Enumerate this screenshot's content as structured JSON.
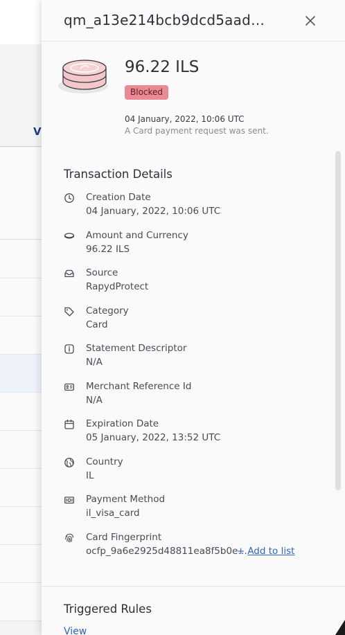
{
  "background": {
    "partial_text": "V"
  },
  "drawer": {
    "title": "qm_a13e214bcb9dcd5aadd...",
    "summary": {
      "amount": "96.22 ILS",
      "status": "Blocked",
      "date": "04 January, 2022, 10:06 UTC",
      "description": "A Card payment request was sent."
    },
    "details_title": "Transaction Details",
    "details": [
      {
        "icon": "clock-icon",
        "label": "Creation Date",
        "value": "04 January, 2022, 10:06 UTC"
      },
      {
        "icon": "coin-icon",
        "label": "Amount and Currency",
        "value": "96.22 ILS"
      },
      {
        "icon": "inbox-icon",
        "label": "Source",
        "value": "RapydProtect"
      },
      {
        "icon": "tag-icon",
        "label": "Category",
        "value": "Card"
      },
      {
        "icon": "info-icon",
        "label": "Statement Descriptor",
        "value": "N/A"
      },
      {
        "icon": "id-card-icon",
        "label": "Merchant Reference Id",
        "value": "N/A"
      },
      {
        "icon": "calendar-icon",
        "label": "Expiration Date",
        "value": "05 January, 2022, 13:52 UTC"
      },
      {
        "icon": "globe-icon",
        "label": "Country",
        "value": "IL"
      },
      {
        "icon": "money-icon",
        "label": "Payment Method",
        "value": "il_visa_card"
      },
      {
        "icon": "fingerprint-icon",
        "label": "Card Fingerprint",
        "value": "ocfp_9a6e2925d48811ea8f5b0e5..."
      }
    ],
    "add_to_list": {
      "plus": "+",
      "label": "Add to list"
    },
    "rules_title": "Triggered Rules",
    "view_label": "View"
  },
  "colors": {
    "badge_bg": "#ea8a95",
    "link": "#2d63c8",
    "drawer_bg": "#fafafa"
  }
}
